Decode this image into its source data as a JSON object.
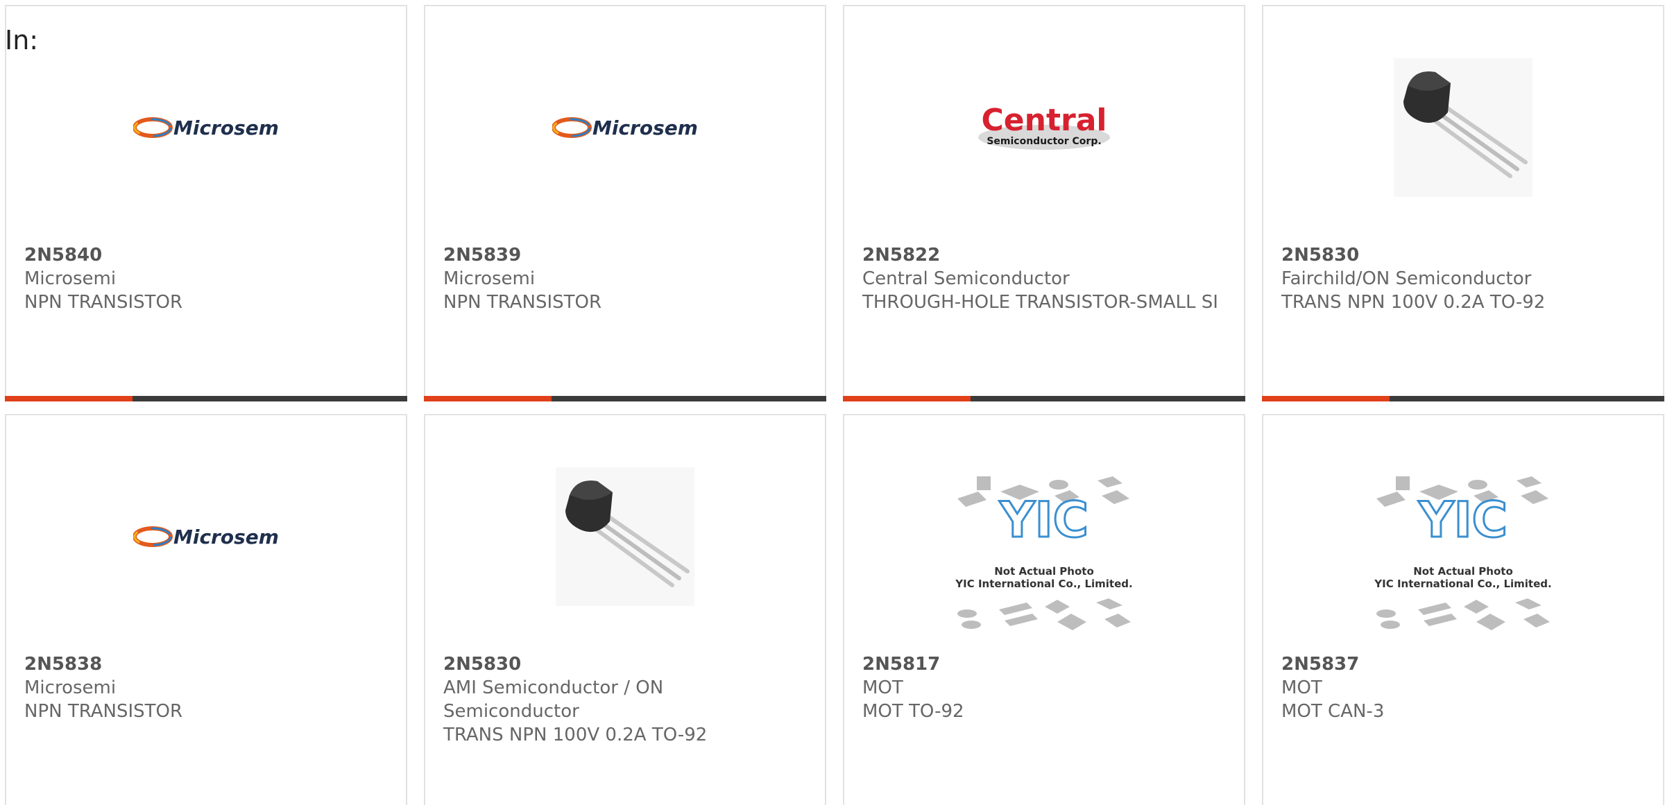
{
  "filter": {
    "label": "In:"
  },
  "colors": {
    "accent": "#e0401a",
    "bar": "#3b3b3b",
    "border": "#e2e2e2",
    "text": "#666666"
  },
  "products": [
    {
      "part": "2N5840",
      "manufacturer": "Microsemi",
      "description": "NPN TRANSISTOR",
      "image": "microsemi-logo",
      "logo_text": "Microsemi"
    },
    {
      "part": "2N5839",
      "manufacturer": "Microsemi",
      "description": "NPN TRANSISTOR",
      "image": "microsemi-logo",
      "logo_text": "Microsemi"
    },
    {
      "part": "2N5822",
      "manufacturer": "Central Semiconductor",
      "description": "THROUGH-HOLE TRANSISTOR-SMALL SI",
      "image": "central-logo",
      "logo_text": "Central",
      "logo_subtext": "Semiconductor Corp."
    },
    {
      "part": "2N5830",
      "manufacturer": "Fairchild/ON Semiconductor",
      "description": "TRANS NPN 100V 0.2A TO-92",
      "image": "to92-transistor-photo"
    },
    {
      "part": "2N5838",
      "manufacturer": "Microsemi",
      "description": "NPN TRANSISTOR",
      "image": "microsemi-logo",
      "logo_text": "Microsemi"
    },
    {
      "part": "2N5830",
      "manufacturer": "AMI Semiconductor / ON Semiconductor",
      "description": "TRANS NPN 100V 0.2A TO-92",
      "image": "to92-transistor-photo"
    },
    {
      "part": "2N5817",
      "manufacturer": "MOT",
      "description": "MOT TO-92",
      "image": "yic-placeholder",
      "logo_text": "YIC",
      "caption1": "Not Actual Photo",
      "caption2": "YIC International Co., Limited."
    },
    {
      "part": "2N5837",
      "manufacturer": "MOT",
      "description": "MOT CAN-3",
      "image": "yic-placeholder",
      "logo_text": "YIC",
      "caption1": "Not Actual Photo",
      "caption2": "YIC International Co., Limited."
    }
  ]
}
